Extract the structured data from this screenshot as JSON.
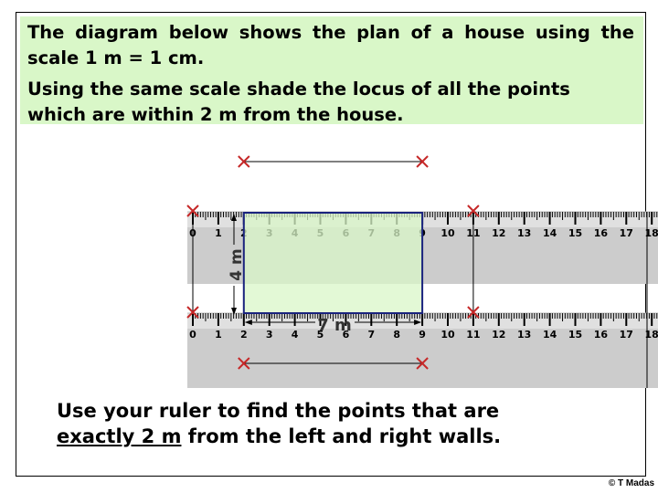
{
  "question": {
    "line1": "The diagram below shows the plan of a house using the scale 1 m = 1 cm.",
    "line2": "Using the same scale shade the locus of all the points which are within 2 m from the house."
  },
  "diagram": {
    "house": {
      "width_label": "7 m",
      "height_label": "4 m",
      "left_cm": 2,
      "right_cm": 9,
      "fill": "#d9f7c8",
      "border": "#1a237e"
    },
    "ruler": {
      "min": 0,
      "max": 18,
      "labels": [
        "0",
        "1",
        "2",
        "3",
        "4",
        "5",
        "6",
        "7",
        "8",
        "9",
        "10",
        "11",
        "12",
        "13",
        "14",
        "15",
        "16",
        "17",
        "18"
      ]
    },
    "construction_points_cm": {
      "left_wall_minus_2": 0,
      "right_wall_plus_2": 11
    },
    "marker_color": "#c62828",
    "ruler_color": "#cccccc"
  },
  "instruction": {
    "prefix_underlined": "exactly 2 m",
    "line1": "Use your ruler to find the points that are",
    "line2_rest": " from the left and right walls."
  },
  "copyright": "© T Madas"
}
